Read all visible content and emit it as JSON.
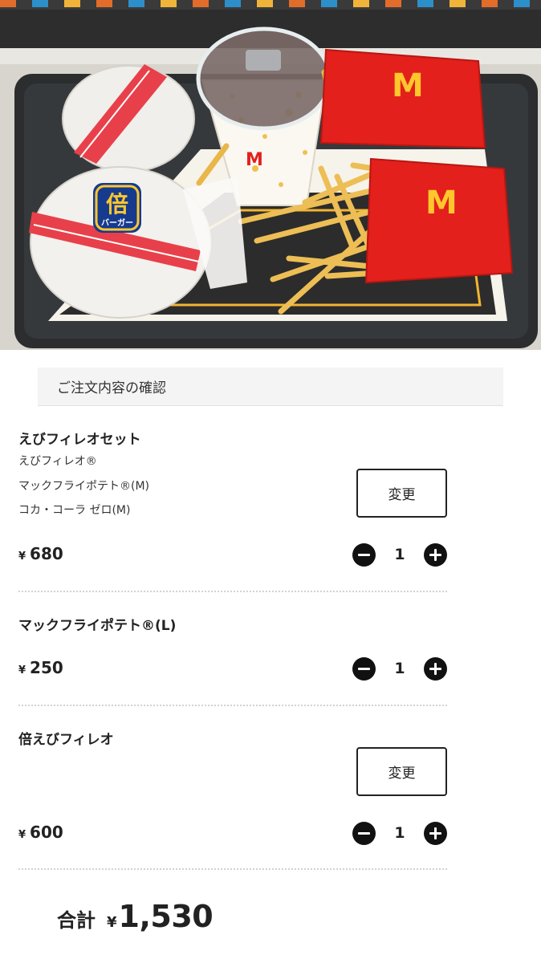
{
  "hero": {
    "burger_badge": "倍",
    "burger_badge_sub": "バーガー",
    "brand_mark": "M"
  },
  "panel": {
    "header": "ご注文内容の確認"
  },
  "items": [
    {
      "name": "えびフィレオセット",
      "subitems": [
        "えびフィレオ®",
        "マックフライポテト®(M)",
        "コカ・コーラ ゼロ(M)"
      ],
      "change_label": "変更",
      "yen": "¥",
      "price": "680",
      "quantity": "1"
    },
    {
      "name": "マックフライポテト®(L)",
      "yen": "¥",
      "price": "250",
      "quantity": "1"
    },
    {
      "name": "倍えびフィレオ",
      "change_label": "変更",
      "yen": "¥",
      "price": "600",
      "quantity": "1"
    }
  ],
  "total": {
    "label": "合計",
    "yen": "¥",
    "amount": "1,530"
  },
  "colors": {
    "button_dark": "#111111",
    "panel_header_bg": "#f4f4f4",
    "fries_box": "#e3201c",
    "brand_yellow": "#ffc72c"
  }
}
